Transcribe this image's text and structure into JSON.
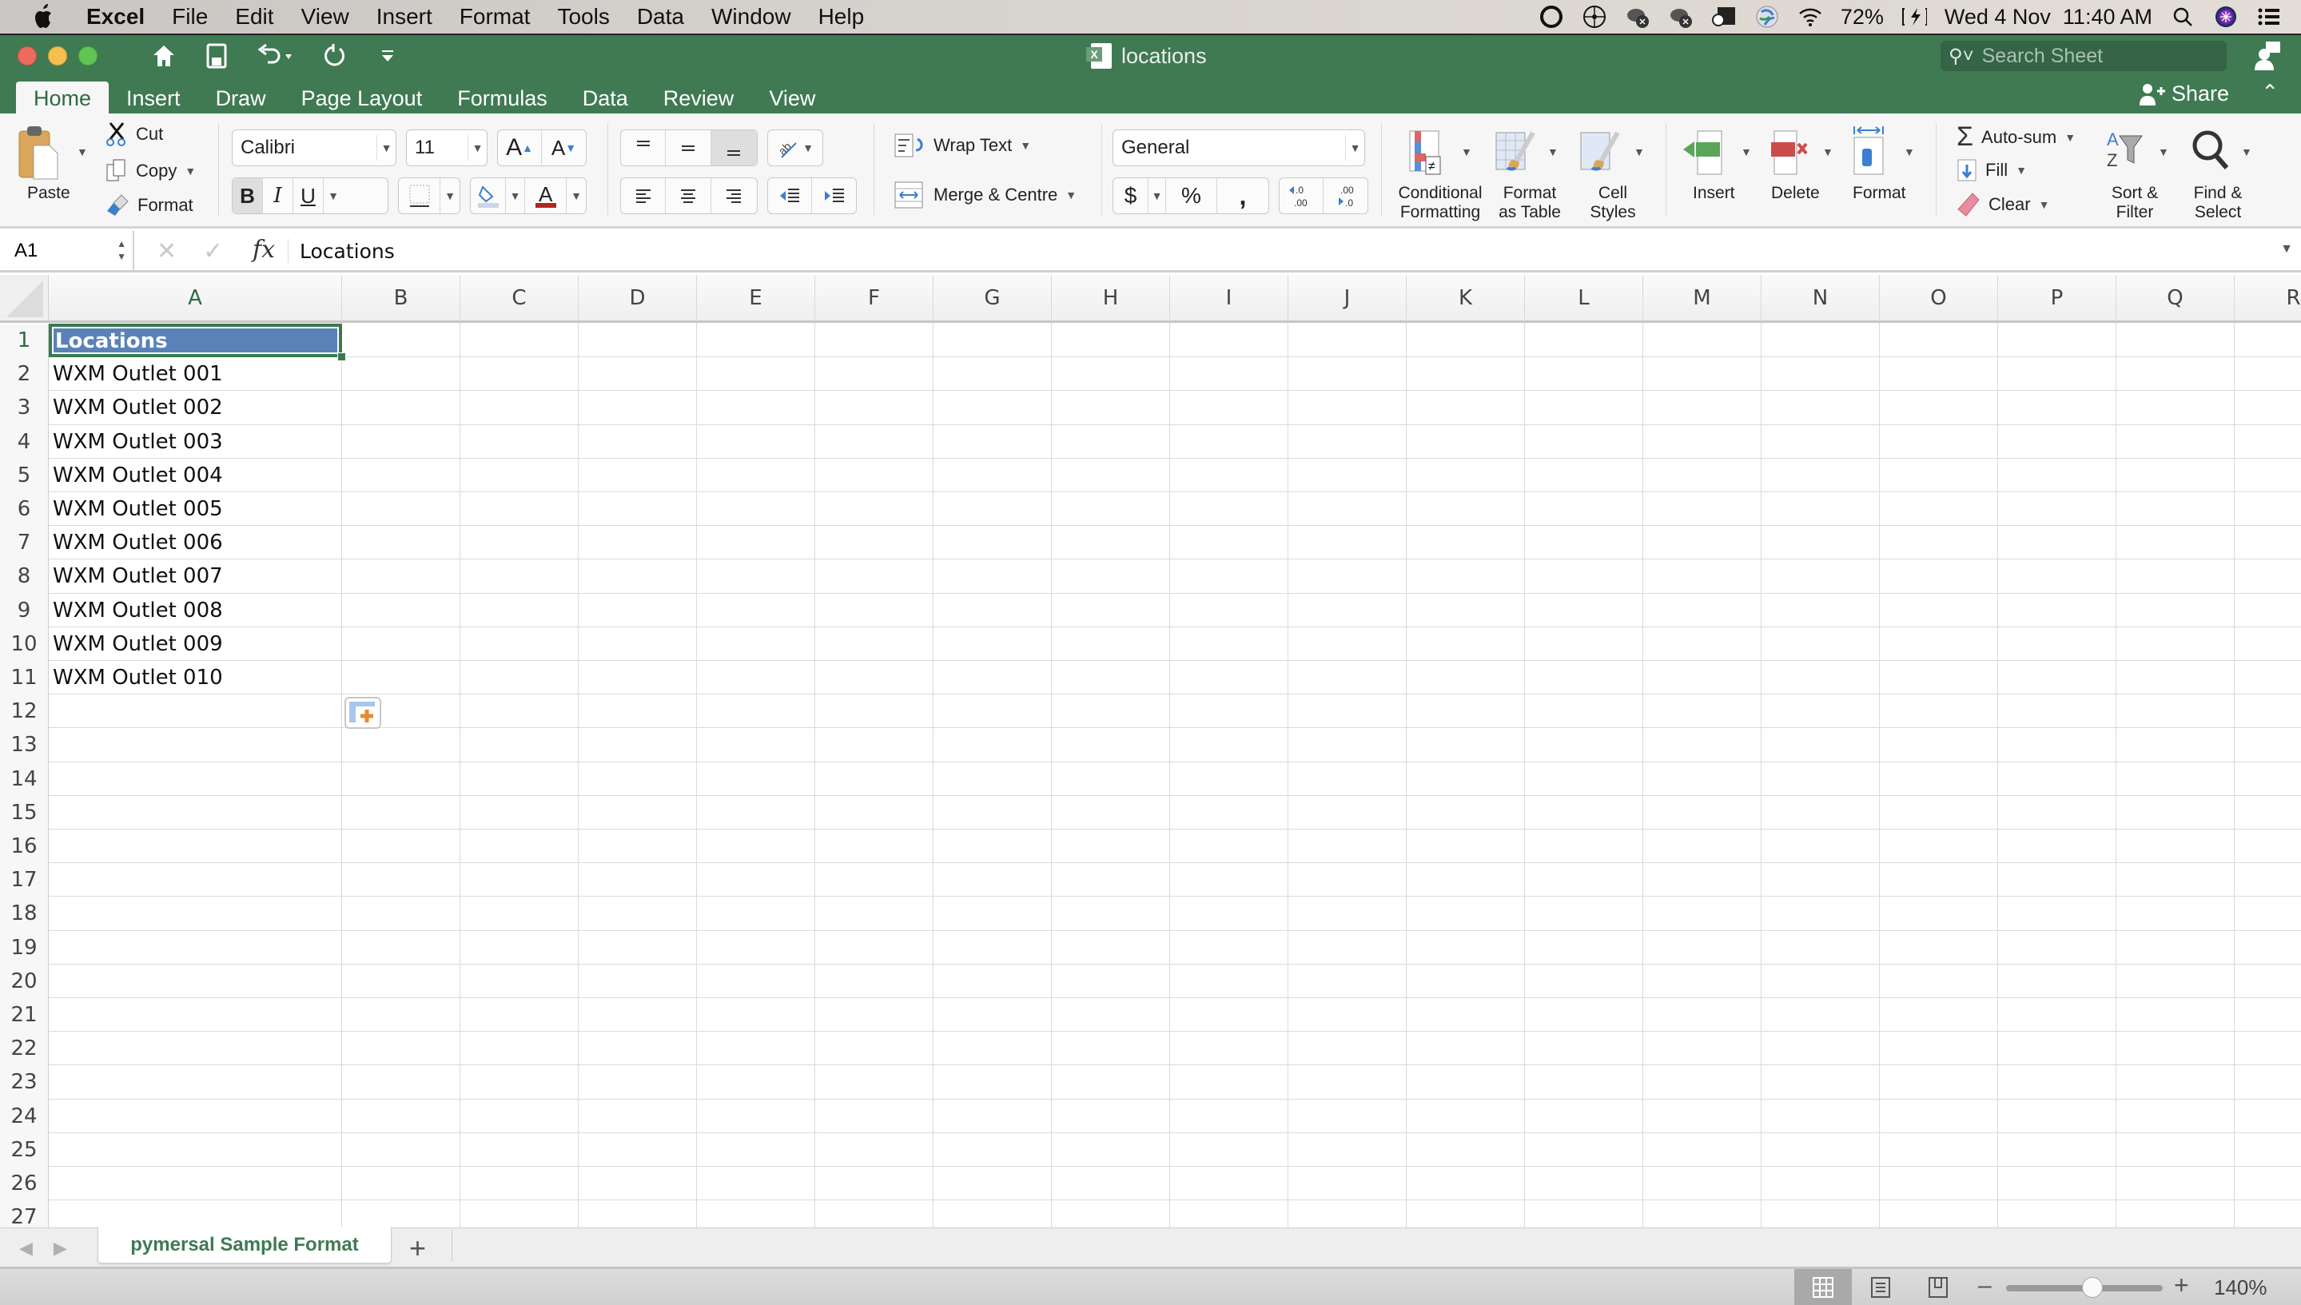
{
  "menubar": {
    "app": "Excel",
    "items": [
      "File",
      "Edit",
      "View",
      "Insert",
      "Format",
      "Tools",
      "Data",
      "Window",
      "Help"
    ],
    "battery": "72%",
    "datetime": "Wed 4 Nov  11:40 AM"
  },
  "window": {
    "title": "locations",
    "search_placeholder": "Search Sheet",
    "tabs": [
      "Home",
      "Insert",
      "Draw",
      "Page Layout",
      "Formulas",
      "Data",
      "Review",
      "View"
    ],
    "active_tab": "Home",
    "share_label": "Share"
  },
  "ribbon": {
    "paste": "Paste",
    "cut": "Cut",
    "copy": "Copy",
    "format_painter": "Format",
    "font_name": "Calibri",
    "font_size": "11",
    "bold": "B",
    "italic": "I",
    "underline": "U",
    "wrap_text": "Wrap Text",
    "merge_centre": "Merge & Centre",
    "number_format": "General",
    "currency": "$",
    "percent": "%",
    "comma": ",",
    "conditional_formatting": [
      "Conditional",
      "Formatting"
    ],
    "format_as_table": [
      "Format",
      "as Table"
    ],
    "cell_styles": [
      "Cell",
      "Styles"
    ],
    "insert": "Insert",
    "delete": "Delete",
    "format": "Format",
    "autosum": "Auto-sum",
    "fill": "Fill",
    "clear": "Clear",
    "sort_filter": [
      "Sort &",
      "Filter"
    ],
    "find_select": [
      "Find &",
      "Select"
    ],
    "colors": {
      "font_color": "#b3261e",
      "fill_color": "#c8d6ea"
    }
  },
  "formula_bar": {
    "name_box": "A1",
    "content": "Locations"
  },
  "sheet": {
    "columns": [
      "A",
      "B",
      "C",
      "D",
      "E",
      "F",
      "G",
      "H",
      "I",
      "J",
      "K",
      "L",
      "M",
      "N",
      "O",
      "P",
      "Q",
      "R"
    ],
    "rows": [
      "1",
      "2",
      "3",
      "4",
      "5",
      "6",
      "7",
      "8",
      "9",
      "10",
      "11",
      "12",
      "13",
      "14",
      "15",
      "16",
      "17",
      "18",
      "19",
      "20",
      "21",
      "22",
      "23",
      "24",
      "25",
      "26",
      "27"
    ],
    "selected_cell": "A1",
    "cells_A": [
      "Locations",
      "WXM Outlet 001",
      "WXM Outlet 002",
      "WXM Outlet 003",
      "WXM Outlet 004",
      "WXM Outlet 005",
      "WXM Outlet 006",
      "WXM Outlet 007",
      "WXM Outlet 008",
      "WXM Outlet 009",
      "WXM Outlet 010"
    ],
    "header_fill": "#5a82b8"
  },
  "sheet_tabs": {
    "tabs": [
      "pymersal Sample Format"
    ],
    "active": "pymersal Sample Format"
  },
  "statusbar": {
    "zoom": "140%",
    "zoom_fraction": 0.56
  }
}
